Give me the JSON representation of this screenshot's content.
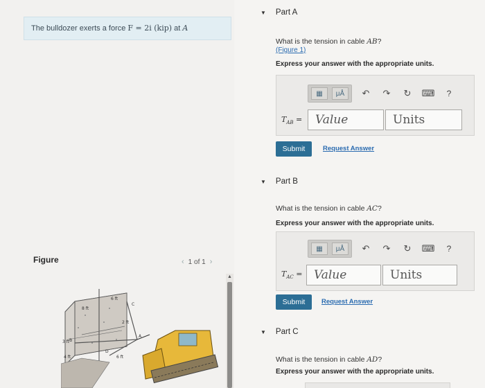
{
  "problem": {
    "prefix": "The bulldozer exerts a force ",
    "force_expr": "F = 2i (kip)",
    "suffix": " at ",
    "point": "A"
  },
  "figure": {
    "label": "Figure",
    "pager": "1 of 1",
    "prev_icon": "chevron-left-icon",
    "next_icon": "chevron-right-icon",
    "dims": [
      "6 ft",
      "8 ft",
      "2 ft",
      "3 ft",
      "4 ft",
      "6 ft"
    ],
    "points": [
      "A",
      "B",
      "C",
      "D"
    ]
  },
  "parts": [
    {
      "title": "Part A",
      "question_prefix": "What is the tension in cable ",
      "cable": "AB",
      "question_suffix": "?",
      "figure_link": "(Figure 1)",
      "instruction": "Express your answer with the appropriate units.",
      "var_label": "T",
      "var_sub": "AB",
      "value_placeholder": "Value",
      "units_placeholder": "Units",
      "submit": "Submit",
      "request": "Request Answer"
    },
    {
      "title": "Part B",
      "question_prefix": "What is the tension in cable ",
      "cable": "AC",
      "question_suffix": "?",
      "instruction": "Express your answer with the appropriate units.",
      "var_label": "T",
      "var_sub": "AC",
      "value_placeholder": "Value",
      "units_placeholder": "Units",
      "submit": "Submit",
      "request": "Request Answer"
    },
    {
      "title": "Part C",
      "question_prefix": "What is the tension in cable ",
      "cable": "AD",
      "question_suffix": "?",
      "instruction": "Express your answer with the appropriate units."
    }
  ],
  "toolbar": {
    "templates_label": "templates",
    "units_label": "μÅ",
    "help_label": "?"
  },
  "colors": {
    "accent": "#2c6e95",
    "link": "#2a6bb0",
    "problem_bg": "#e2eef3"
  }
}
